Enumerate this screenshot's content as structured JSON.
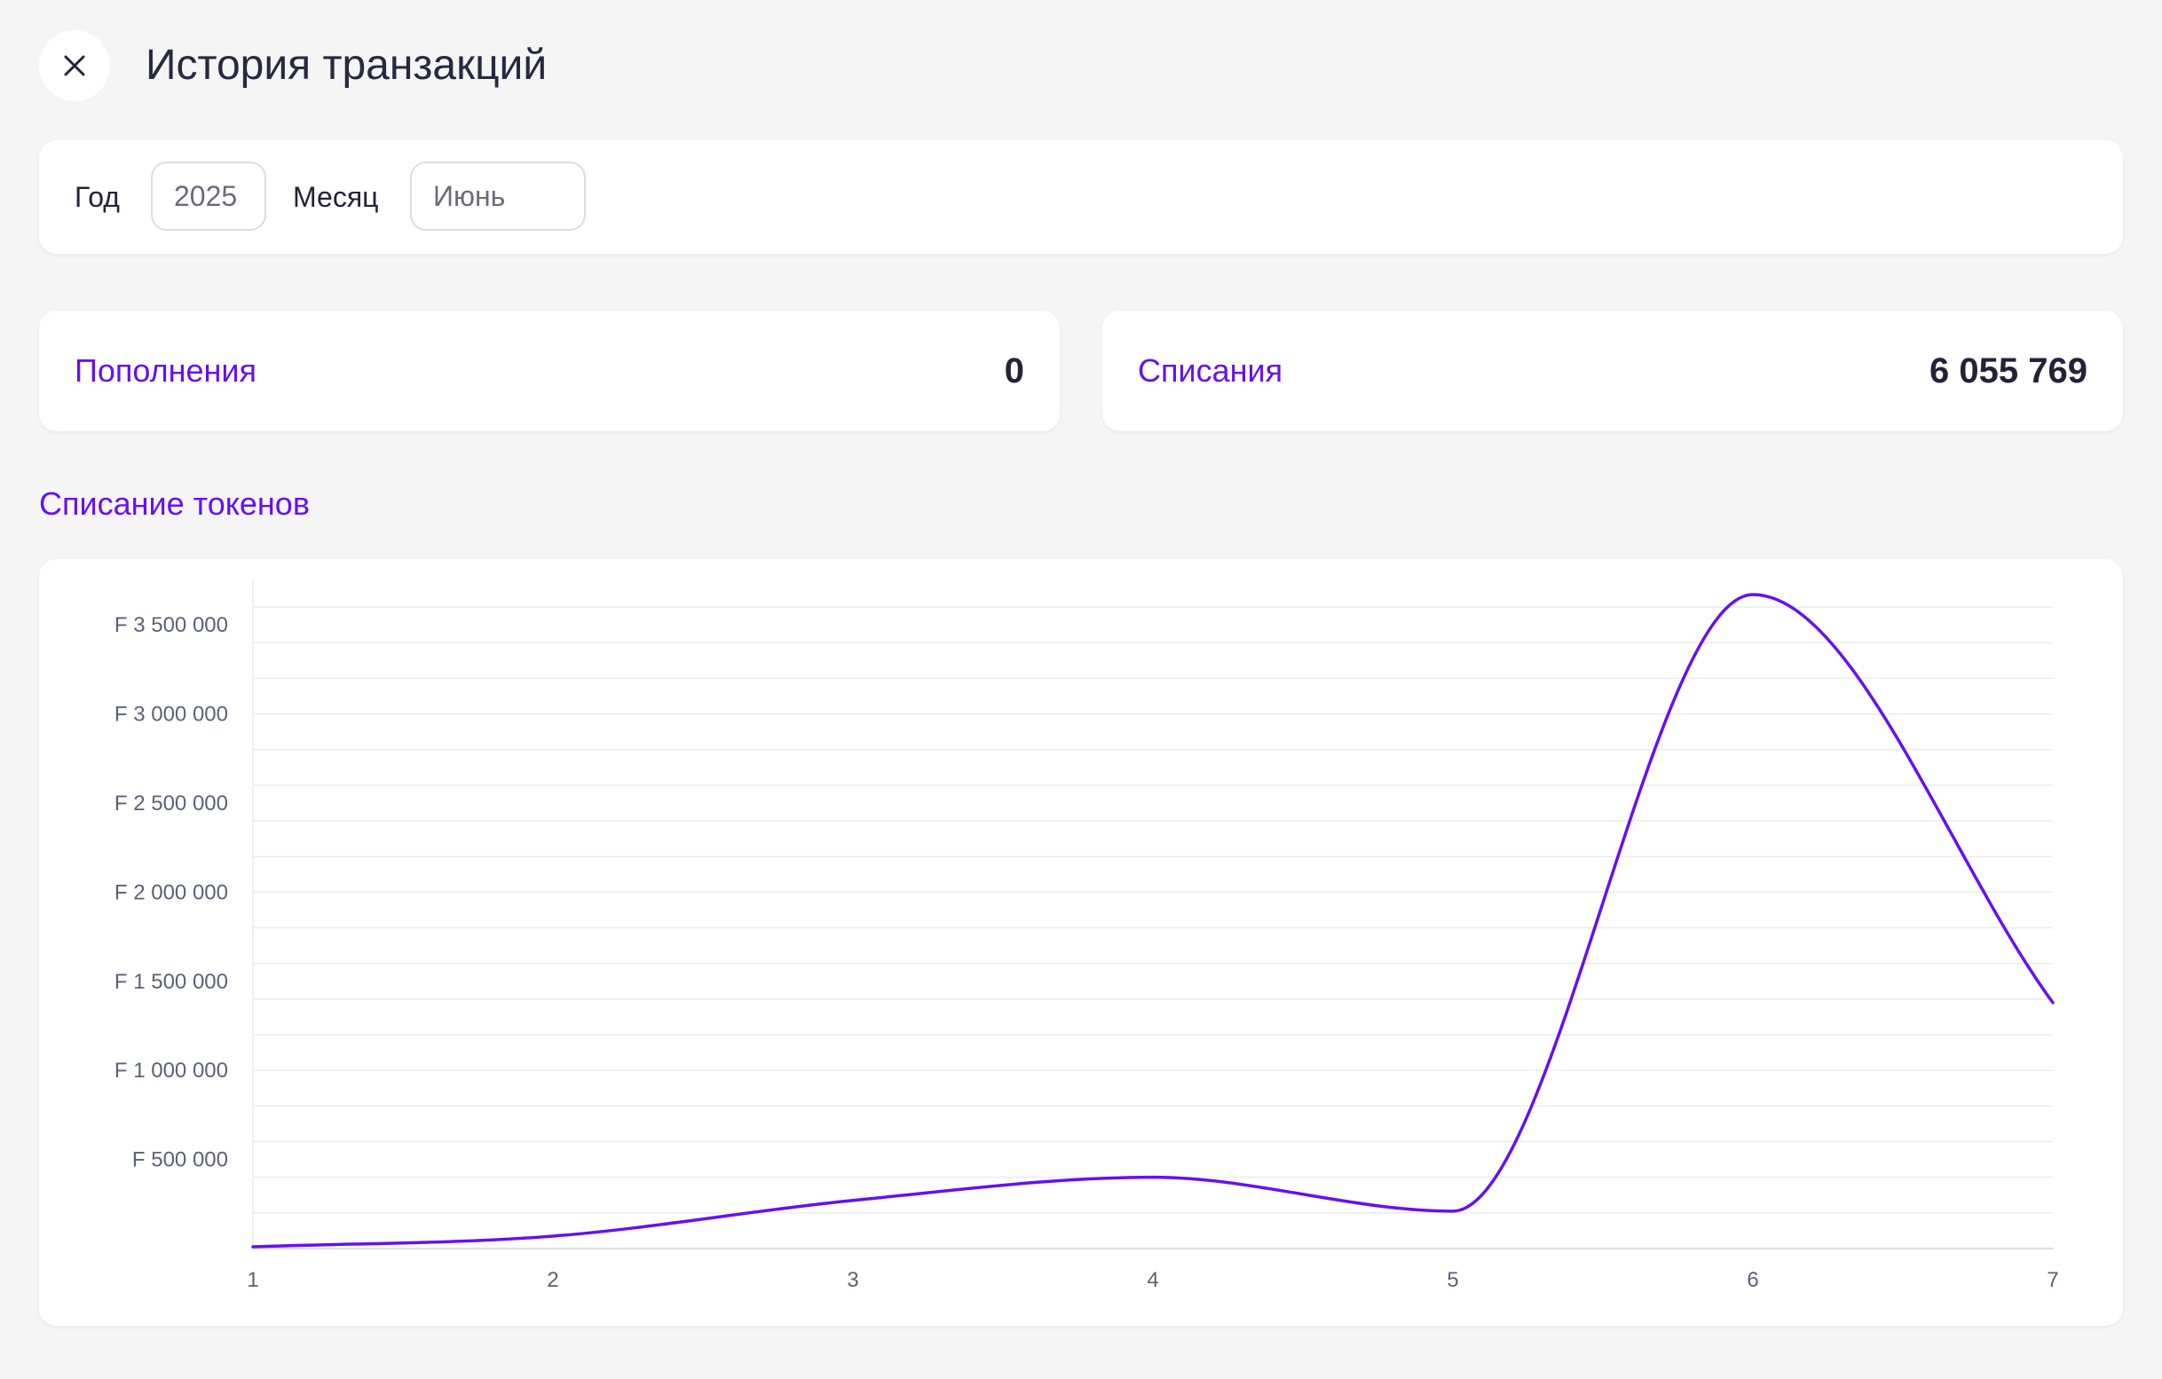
{
  "header": {
    "title": "История транзакций",
    "close_icon": "close-icon"
  },
  "filters": {
    "year_label": "Год",
    "year_value": "2025",
    "month_label": "Месяц",
    "month_value": "Июнь"
  },
  "stats": {
    "topups_label": "Пополнения",
    "topups_value": "0",
    "writeoffs_label": "Списания",
    "writeoffs_value": "6 055 769"
  },
  "chart_section": {
    "title": "Списание токенов"
  },
  "colors": {
    "accent": "#6610f2",
    "background": "#f5f5f6",
    "card": "#ffffff",
    "text": "#24223a",
    "grid": "#ececf0",
    "axis_text": "#5b6275"
  },
  "chart_data": {
    "type": "line",
    "title": "",
    "xlabel": "",
    "ylabel": "",
    "x": [
      1,
      2,
      3,
      4,
      5,
      6,
      7
    ],
    "series": [
      {
        "values": [
          10000,
          70000,
          270000,
          400000,
          210000,
          3670000,
          1380000
        ]
      }
    ],
    "ylim": [
      0,
      3700000
    ],
    "y_ticks": [
      500000,
      1000000,
      1500000,
      2000000,
      2500000,
      3000000,
      3500000
    ],
    "y_tick_labels": [
      "F 500 000",
      "F 1 000 000",
      "F 1 500 000",
      "F 2 000 000",
      "F 2 500 000",
      "F 3 000 000",
      "F 3 500 000"
    ],
    "x_tick_labels": [
      "1",
      "2",
      "3",
      "4",
      "5",
      "6",
      "7"
    ],
    "grid": true,
    "legend": "none",
    "curve": "smooth",
    "color": "#6610f2"
  }
}
